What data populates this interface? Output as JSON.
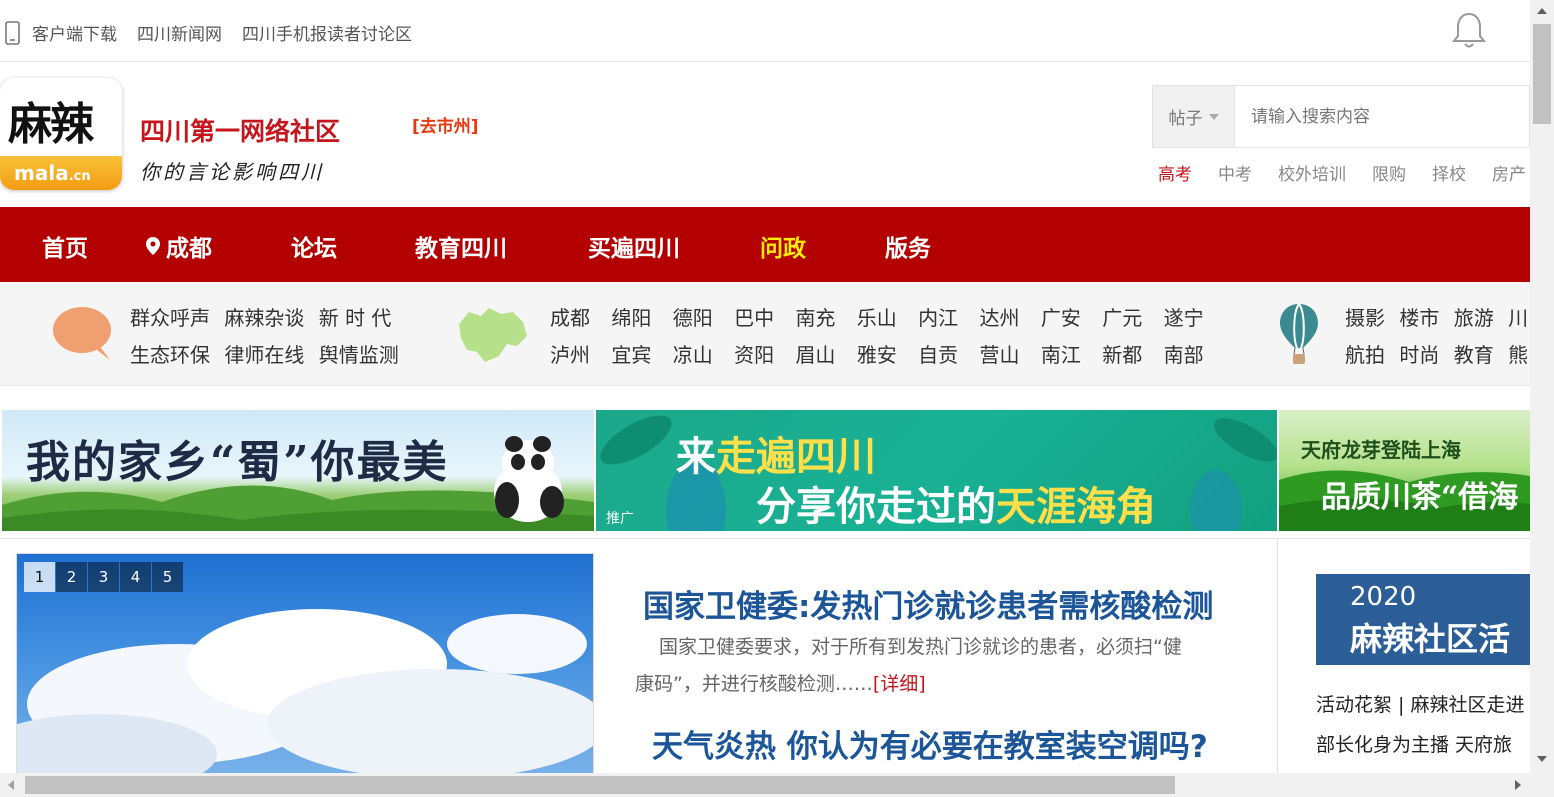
{
  "topbar": {
    "links": [
      "客户端下载",
      "四川新闻网",
      "四川手机报读者讨论区"
    ]
  },
  "header": {
    "logo": {
      "cn": "麻辣",
      "en": "mala",
      "en_suffix": ".cn"
    },
    "slogan_title": "四川第一网络社区",
    "slogan_sub": "你的言论影响四川",
    "goto_city": "[去市州]"
  },
  "search": {
    "scope": "帖子",
    "placeholder": "请输入搜索内容",
    "hot": [
      "高考",
      "中考",
      "校外培训",
      "限购",
      "择校",
      "房产"
    ]
  },
  "nav": {
    "items": [
      "首页",
      "成都",
      "论坛",
      "教育四川",
      "买遍四川",
      "问政",
      "版务"
    ]
  },
  "quick": {
    "community_row1": [
      "群众呼声",
      "麻辣杂谈",
      "新 时 代"
    ],
    "community_row2": [
      "生态环保",
      "律师在线",
      "舆情监测"
    ],
    "cities_row1": [
      "成都",
      "绵阳",
      "德阳",
      "巴中",
      "南充",
      "乐山",
      "内江",
      "达州",
      "广安",
      "广元",
      "遂宁"
    ],
    "cities_row2": [
      "泸州",
      "宜宾",
      "凉山",
      "资阳",
      "眉山",
      "雅安",
      "自贡",
      "营山",
      "南江",
      "新都",
      "南部"
    ],
    "topics_row1": [
      "摄影",
      "楼市",
      "旅游",
      "川"
    ],
    "topics_row2": [
      "航拍",
      "时尚",
      "教育",
      "熊"
    ]
  },
  "banners": {
    "b1_text": "我的家乡“蜀”你最美",
    "b2_line1_a": "来",
    "b2_line1_b": "走遍四川",
    "b2_line2_a": "分享你走过的",
    "b2_line2_b": "天涯海角",
    "b2_tag": "推广",
    "b3_line1": "天府龙芽登陆上海",
    "b3_line2": "品质川茶“借海"
  },
  "slider": {
    "pages": [
      "1",
      "2",
      "3",
      "4",
      "5"
    ],
    "active": "1"
  },
  "news": {
    "headline1": "国家卫健委:发热门诊就诊患者需核酸检测",
    "summary_line1": "国家卫健委要求，对于所有到发热门诊就诊的患者，必须扫“健",
    "summary_line2": "康码”，并进行核酸检测……",
    "more": "[详细]",
    "headline2": "天气炎热 你认为有必要在教室装空调吗?"
  },
  "sidebox": {
    "year": "2020",
    "title": "麻辣社区活",
    "link1": "活动花絮 | 麻辣社区走进",
    "link2": "部长化身为主播 天府旅"
  },
  "colors": {
    "brand_red": "#b30000",
    "nav_highlight": "#ffec00",
    "headline_blue": "#1c5698"
  }
}
